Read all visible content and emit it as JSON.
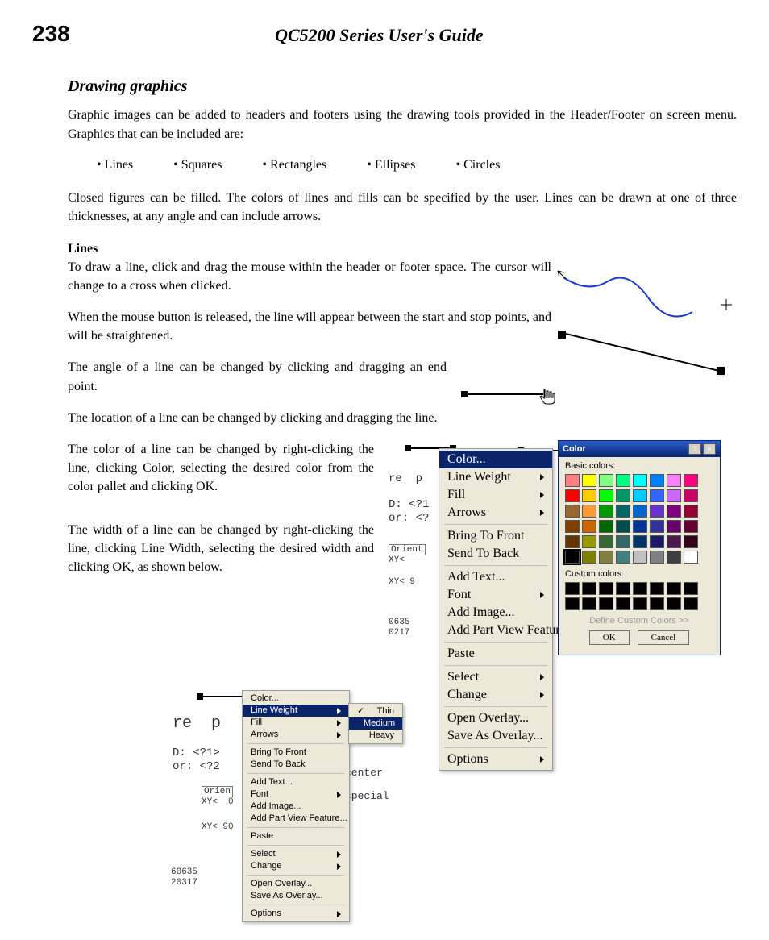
{
  "page": {
    "number": "238",
    "title": "QC5200 Series User's Guide"
  },
  "section": "Drawing graphics",
  "p1": "Graphic images can be added to headers and footers using the drawing tools provided in the Header/Footer on screen menu.  Graphics that can be included are:",
  "bullets": [
    "Lines",
    "Squares",
    "Rectangles",
    "Ellipses",
    "Circles"
  ],
  "p2": "Closed figures can be filled.  The colors of lines and fills can be specified by the user.  Lines can be drawn at one of three thicknesses, at any angle and can include arrows.",
  "subhead": "Lines",
  "p3": "To draw a line, click and drag the mouse within the header or footer space.  The cursor will change to a cross when clicked.",
  "p4": "When the mouse button is released, the line will appear between the start and stop points, and will be straightened.",
  "p5": "The angle of a line can be changed by clicking and dragging an end point.",
  "p6": "The location of a line can be changed by clicking and dragging the line.",
  "p7": "The color of a line can be changed by right-clicking the line, clicking Color, selecting the desired color from the color pallet and clicking OK.",
  "p8": "The width of a line can be changed by right-clicking the line, clicking Line Width, selecting the desired width and clicking OK, as shown below.",
  "menu": {
    "items": [
      {
        "label": "Color...",
        "kind": "item",
        "sub": false
      },
      {
        "label": "Line Weight",
        "kind": "item",
        "sub": true
      },
      {
        "label": "Fill",
        "kind": "item",
        "sub": true
      },
      {
        "label": "Arrows",
        "kind": "item",
        "sub": true
      },
      {
        "kind": "sep"
      },
      {
        "label": "Bring To Front",
        "kind": "item"
      },
      {
        "label": "Send To Back",
        "kind": "item"
      },
      {
        "kind": "sep"
      },
      {
        "label": "Add Text...",
        "kind": "item"
      },
      {
        "label": "Font",
        "kind": "item",
        "sub": true
      },
      {
        "label": "Add Image...",
        "kind": "item"
      },
      {
        "label": "Add Part View Feature...",
        "kind": "item"
      },
      {
        "kind": "sep"
      },
      {
        "label": "Paste",
        "kind": "item"
      },
      {
        "kind": "sep"
      },
      {
        "label": "Select",
        "kind": "item",
        "sub": true
      },
      {
        "label": "Change",
        "kind": "item",
        "sub": true
      },
      {
        "kind": "sep"
      },
      {
        "label": "Open Overlay...",
        "kind": "item"
      },
      {
        "label": "Save As Overlay...",
        "kind": "item"
      },
      {
        "kind": "sep"
      },
      {
        "label": "Options",
        "kind": "item",
        "sub": true
      }
    ],
    "lineWeightSub": [
      "Thin",
      "Medium",
      "Heavy"
    ],
    "selectedTop": "Line Weight",
    "selectedSub": "Medium",
    "checkedSub": "Thin"
  },
  "colorMenuSelected": "Color...",
  "colorDialog": {
    "title": "Color",
    "basicLabel": "Basic colors:",
    "customLabel": "Custom colors:",
    "define": "Define Custom Colors >>",
    "ok": "OK",
    "cancel": "Cancel",
    "basic": [
      "#ff8080",
      "#ffff00",
      "#80ff80",
      "#00ff80",
      "#00ffff",
      "#0080ff",
      "#ff80ff",
      "#ff0080",
      "#ff0000",
      "#ffcc00",
      "#00ff00",
      "#009966",
      "#00ccff",
      "#3366ff",
      "#cc66ff",
      "#cc0066",
      "#996633",
      "#ff9933",
      "#009900",
      "#006666",
      "#0066cc",
      "#6633cc",
      "#800080",
      "#990033",
      "#804000",
      "#cc6600",
      "#006600",
      "#004c4c",
      "#003399",
      "#333399",
      "#660066",
      "#660033",
      "#663300",
      "#999900",
      "#336633",
      "#336666",
      "#003366",
      "#1a1a66",
      "#4c1a4c",
      "#330019",
      "#000000",
      "#808000",
      "#808040",
      "#408080",
      "#c0c0c0",
      "#808080",
      "#404040",
      "#ffffff"
    ],
    "custom": [
      "#000000",
      "#000000",
      "#000000",
      "#000000",
      "#000000",
      "#000000",
      "#000000",
      "#000000",
      "#000000",
      "#000000",
      "#000000",
      "#000000",
      "#000000",
      "#000000",
      "#000000",
      "#000000"
    ],
    "selectedIndex": 40
  },
  "bg": {
    "re": "re  p",
    "d": "D: <?1",
    "or": "or: <?",
    "d2": "D: <?1>",
    "or2": "or: <?2",
    "orient": "Orient",
    "orient2": "Orien",
    "xy1": "XY<  ",
    "xy2": "XY< 9",
    "xy3": "XY<  0",
    "xy4": "XY< 90",
    "id1": "0635",
    "id2": "0217",
    "id3": "60635",
    "id4": "20317",
    "center": "center",
    "special": "special"
  }
}
